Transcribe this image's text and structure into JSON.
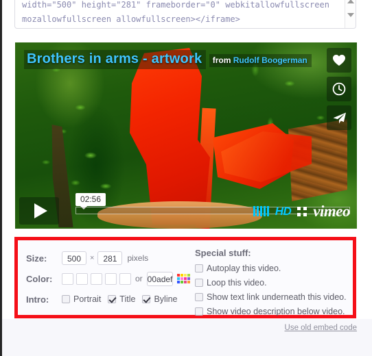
{
  "embed_code": {
    "line1": "width=\"500\" height=\"281\" frameborder=\"0\" webkitallowfullscreen",
    "line2": "mozallowfullscreen allowfullscreen></iframe>"
  },
  "scrollbar": {
    "up_icon": "triangle-up-icon",
    "down_icon": "triangle-down-icon"
  },
  "video": {
    "title": "Brothers in arms - artwork",
    "byline_prefix": "from",
    "byline_author": "Rudolf Boogerman",
    "time_tooltip": "02:56",
    "hd_badge": "HD",
    "brand": "vimeo",
    "actions": [
      {
        "name": "like-heart-icon",
        "label": "Like"
      },
      {
        "name": "watch-later-clock-icon",
        "label": "Watch Later"
      },
      {
        "name": "share-paper-plane-icon",
        "label": "Share"
      }
    ],
    "play_icon": "play-icon",
    "volume_icon": "volume-bars-icon",
    "fullscreen_icon": "fullscreen-icon"
  },
  "settings": {
    "size": {
      "label": "Size:",
      "width": "500",
      "separator": "×",
      "height": "281",
      "unit": "pixels"
    },
    "color": {
      "label": "Color:",
      "swatches": [
        "#ffffff",
        "#ffffff",
        "#ffffff",
        "#ffffff",
        "#ffffff"
      ],
      "or_text": "or",
      "hex_value": "00adef",
      "picker_icon": "color-picker-grid-icon",
      "picker_colors": [
        "#ff3333",
        "#ffd400",
        "#ffee55",
        "#a8e040",
        "#2ec4f1",
        "#ff7ad9",
        "#ff3399",
        "#7f5bd6",
        "#3355ff",
        "#66cc33",
        "#e84a8a",
        "#ff9933"
      ]
    },
    "intro": {
      "label": "Intro:",
      "options": [
        {
          "label": "Portrait",
          "checked": false
        },
        {
          "label": "Title",
          "checked": true
        },
        {
          "label": "Byline",
          "checked": true
        }
      ]
    },
    "special": {
      "title": "Special stuff:",
      "options": [
        {
          "label": "Autoplay this video.",
          "checked": false
        },
        {
          "label": "Loop this video.",
          "checked": false
        },
        {
          "label": "Show text link underneath this video.",
          "checked": false
        },
        {
          "label": "Show video description below video.",
          "checked": false
        }
      ]
    },
    "border_color": "#f50f18"
  },
  "footer": {
    "old_embed_link": "Use old embed code"
  }
}
